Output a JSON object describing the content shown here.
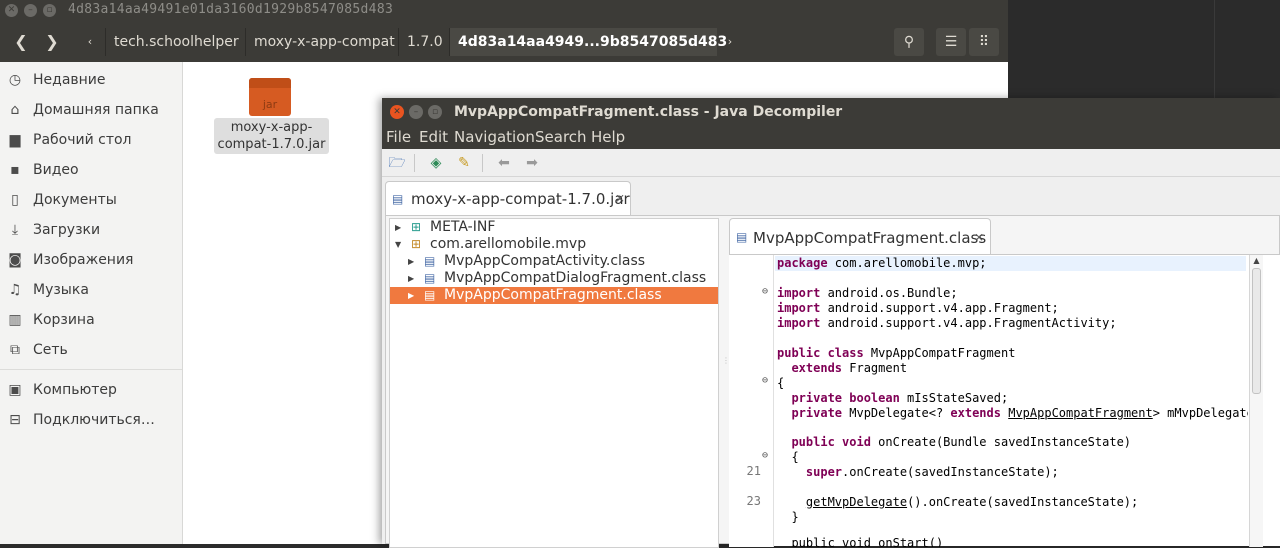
{
  "file_manager": {
    "title": "4d83a14aa49491e01da3160d1929b8547085d483",
    "breadcrumbs": [
      "tech.schoolhelper",
      "moxy-x-app-compat",
      "1.7.0",
      "4d83a14aa4949...9b8547085d483"
    ],
    "sidebar": {
      "items": [
        {
          "icon": "clock-icon",
          "label": "Недавние"
        },
        {
          "icon": "home-icon",
          "label": "Домашняя папка"
        },
        {
          "icon": "folder-icon",
          "label": "Рабочий стол"
        },
        {
          "icon": "video-icon",
          "label": "Видео"
        },
        {
          "icon": "document-icon",
          "label": "Документы"
        },
        {
          "icon": "download-icon",
          "label": "Загрузки"
        },
        {
          "icon": "camera-icon",
          "label": "Изображения"
        },
        {
          "icon": "music-icon",
          "label": "Музыка"
        },
        {
          "icon": "trash-icon",
          "label": "Корзина"
        },
        {
          "icon": "network-icon",
          "label": "Сеть"
        },
        {
          "icon": "computer-icon",
          "label": "Компьютер"
        },
        {
          "icon": "connect-icon",
          "label": "Подключиться…"
        }
      ]
    },
    "file": {
      "icon_text": "jar",
      "label": "moxy-x-app-compat-1.7.0.jar"
    }
  },
  "jd": {
    "title": "MvpAppCompatFragment.class - Java Decompiler",
    "menu": [
      "File",
      "Edit",
      "Navigation",
      "Search",
      "Help"
    ],
    "jar_tab": "moxy-x-app-compat-1.7.0.jar",
    "tree": [
      {
        "label": "META-INF",
        "icon": "package-icon"
      },
      {
        "label": "com.arellomobile.mvp",
        "icon": "package-icon"
      },
      {
        "label": "MvpAppCompatActivity.class",
        "icon": "class-file-icon"
      },
      {
        "label": "MvpAppCompatDialogFragment.class",
        "icon": "class-file-icon"
      },
      {
        "label": "MvpAppCompatFragment.class",
        "icon": "class-file-icon"
      }
    ],
    "editor_tab": "MvpAppCompatFragment.class",
    "line_numbers": [
      "21",
      "23"
    ],
    "code": {
      "package_kw": "package",
      "package_name": " com.arellomobile.mvp;",
      "import_kw": "import",
      "imports": [
        " android.os.Bundle;",
        " android.support.v4.app.Fragment;",
        " android.support.v4.app.FragmentActivity;"
      ],
      "public_class_kw": "public class",
      "class_name": " MvpAppCompatFragment",
      "extends_kw": "extends",
      "extends_name": " Fragment",
      "open_brace": "{",
      "close_brace": "}",
      "private_boolean_kw": "private boolean",
      "field1_name": " mIsStateSaved;",
      "private_kw": "private",
      "field2_type": " MvpDelegate<? ",
      "field2_extends_kw": "extends",
      "field2_bound": "MvpAppCompatFragment",
      "field2_rest": "> mMvpDelegate;",
      "public_void_kw": "public void",
      "method_sig": " onCreate(Bundle savedInstanceState)",
      "super_kw": "super",
      "super_call": ".onCreate(savedInstanceState);",
      "delegate_link": "getMvpDelegate",
      "delegate_call": "().onCreate(savedInstanceState);",
      "next_line": "public void onStart()"
    }
  }
}
